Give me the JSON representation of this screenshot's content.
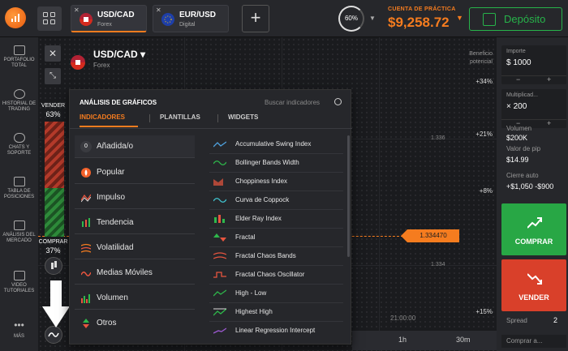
{
  "topbar": {
    "tabs": [
      {
        "name": "USD/CAD",
        "sub": "Forex"
      },
      {
        "name": "EUR/USD",
        "sub": "Digital"
      }
    ],
    "add_tab": "+",
    "timer": "60%",
    "balance_label": "CUENTA DE PRÁCTICA",
    "balance": "$9,258.72",
    "deposit_label": "Depósito"
  },
  "sidebar": {
    "items": [
      {
        "label": "PORTAFOLIO TOTAL"
      },
      {
        "label": "HISTORIAL DE TRADING"
      },
      {
        "label": "CHATS Y SOPORTE"
      },
      {
        "label": "TABLA DE POSICIONES"
      },
      {
        "label": "ANÁLISIS DEL MERCADO"
      },
      {
        "label": "VIDEO TUTORIALES"
      },
      {
        "label": "MÁS"
      }
    ]
  },
  "chart": {
    "asset_name": "USD/CAD",
    "asset_type": "Forex",
    "benefit_label": "Beneficio potencial",
    "percents": [
      "+34%",
      "+21%",
      "+8%",
      "+15%"
    ],
    "prices": [
      "1.336",
      "1.334"
    ],
    "current_price": "1.334470",
    "time_label": "21:00:00",
    "timeframes": [
      "1h",
      "30m"
    ],
    "sell_label": "VENDER",
    "sell_pct": "63%",
    "buy_label": "COMPRAR",
    "buy_pct": "37%"
  },
  "panel": {
    "title": "ANÁLISIS DE GRÁFICOS",
    "search_placeholder": "Buscar indicadores",
    "tabs": [
      "INDICADORES",
      "PLANTILLAS",
      "WIDGETS"
    ],
    "added_count": "0",
    "categories": [
      "Añadida/o",
      "Popular",
      "Impulso",
      "Tendencia",
      "Volatilidad",
      "Medias Móviles",
      "Volumen",
      "Otros"
    ],
    "indicators": [
      "Accumulative Swing Index",
      "Bollinger Bands Width",
      "Choppiness Index",
      "Curva de Coppock",
      "Elder Ray Index",
      "Fractal",
      "Fractal Chaos Bands",
      "Fractal Chaos Oscillator",
      "High - Low",
      "Highest High",
      "Linear Regression Intercept"
    ]
  },
  "right": {
    "amount_label": "Importe",
    "amount": "$ 1000",
    "multiplier_label": "Multiplicad...",
    "multiplier": "× 200",
    "volume_label": "Volumen",
    "volume": "$200K",
    "pip_label": "Valor de pip",
    "pip": "$14.99",
    "autoclose_label": "Cierre auto",
    "autoclose": "+$1,050 -$900",
    "buy_label": "COMPRAR",
    "sell_label": "VENDER",
    "spread_label": "Spread",
    "spread": "2",
    "buy_at": "Comprar a..."
  }
}
